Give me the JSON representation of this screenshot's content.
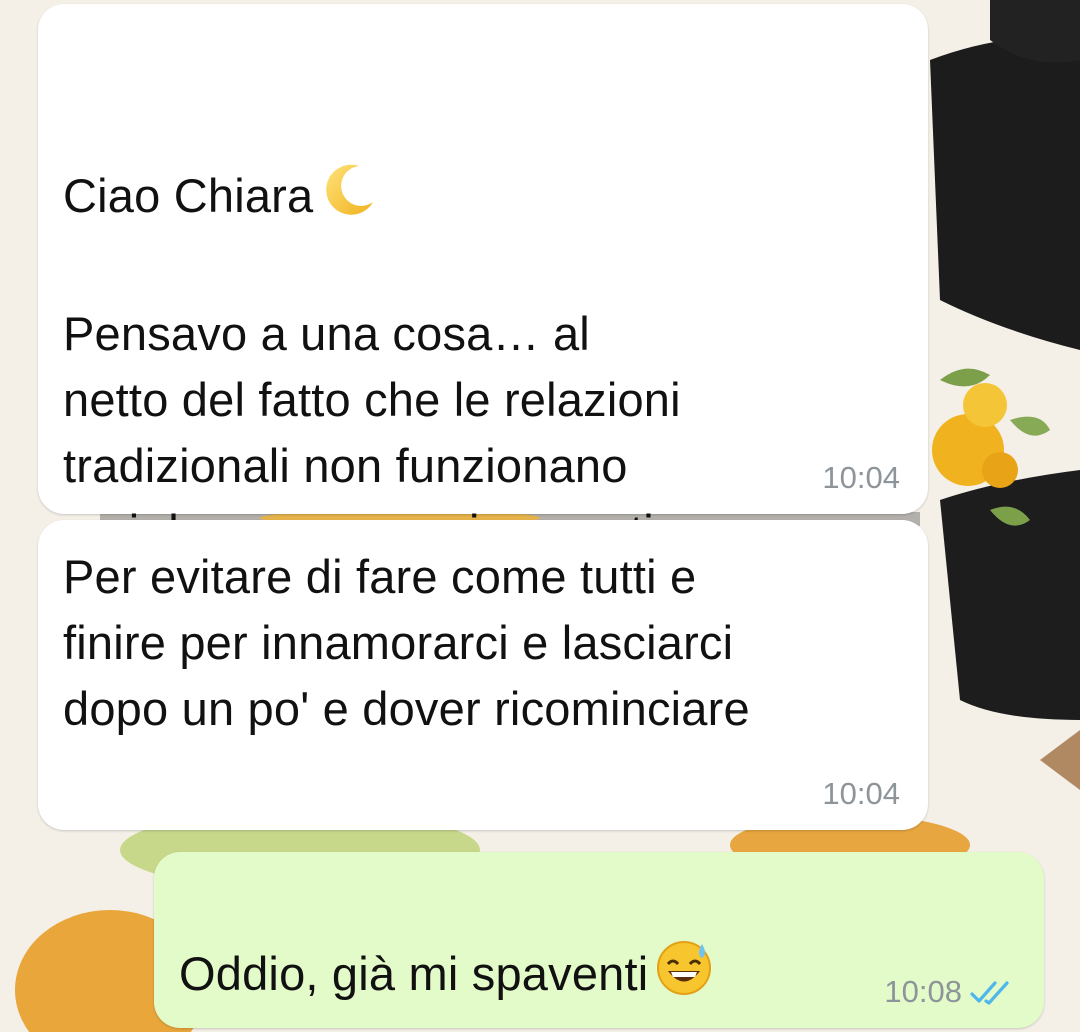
{
  "messages": [
    {
      "direction": "incoming",
      "text": "Ciao Chiara",
      "text_continued": "Pensavo a una cosa… al\nnetto del fatto che le relazioni\ntradizionali non funzionano\nmai davvero...vorrei proporti un\nmodo diverso di stare insieme...",
      "emoji": "crescent-moon",
      "time": "10:04"
    },
    {
      "direction": "incoming",
      "text": "Per evitare di fare come tutti e\nfinire per innamorarci e lasciarci\ndopo un po' e dover ricominciare",
      "time": "10:04"
    },
    {
      "direction": "outgoing",
      "text": "Oddio, già mi spaventi",
      "emoji": "grinning-sweat",
      "time": "10:08",
      "status": "read",
      "tick_color": "#4fb6ec"
    }
  ]
}
